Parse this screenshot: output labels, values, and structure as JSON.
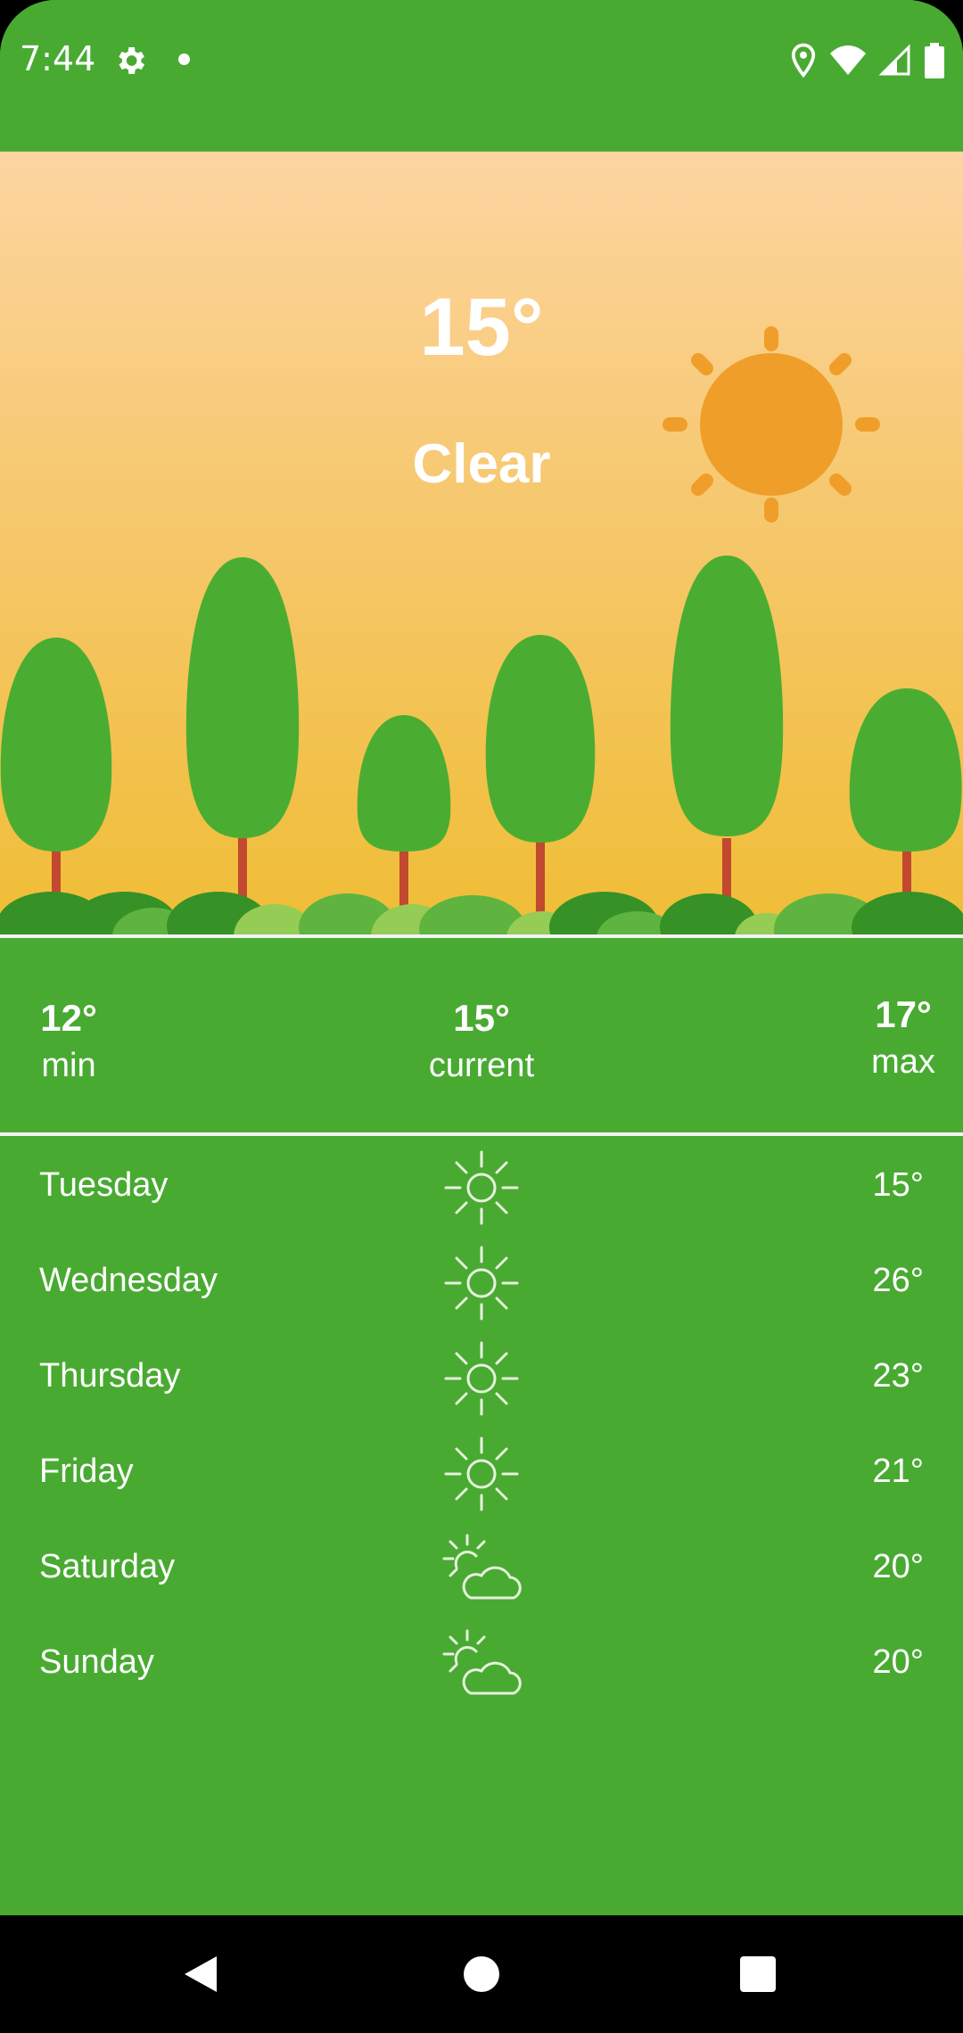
{
  "status_bar": {
    "time": "7:44",
    "icons": [
      "gear-icon",
      "notification-dot-icon",
      "location-pin-icon",
      "wifi-icon",
      "cell-signal-icon",
      "battery-icon"
    ]
  },
  "hero": {
    "temperature": "15°",
    "condition": "Clear",
    "scene_icon": "sun-icon"
  },
  "summary": {
    "min": {
      "value": "12°",
      "label": "min"
    },
    "current": {
      "value": "15°",
      "label": "current"
    },
    "max": {
      "value": "17°",
      "label": "max"
    }
  },
  "forecast": [
    {
      "day": "Tuesday",
      "icon": "sunny-icon",
      "temp": "15°"
    },
    {
      "day": "Wednesday",
      "icon": "sunny-icon",
      "temp": "26°"
    },
    {
      "day": "Thursday",
      "icon": "sunny-icon",
      "temp": "23°"
    },
    {
      "day": "Friday",
      "icon": "sunny-icon",
      "temp": "21°"
    },
    {
      "day": "Saturday",
      "icon": "partly-cloudy-icon",
      "temp": "20°"
    },
    {
      "day": "Sunday",
      "icon": "partly-cloudy-icon",
      "temp": "20°"
    }
  ],
  "nav_bar": {
    "buttons": [
      "back-icon",
      "home-icon",
      "recents-icon"
    ]
  },
  "colors": {
    "primary_green": "#49aa32",
    "sun": "#f09e2a",
    "sky_top": "#fdd5a1",
    "sky_bottom": "#f0bd35",
    "tree": "#4aad32",
    "trunk": "#c2482f"
  }
}
